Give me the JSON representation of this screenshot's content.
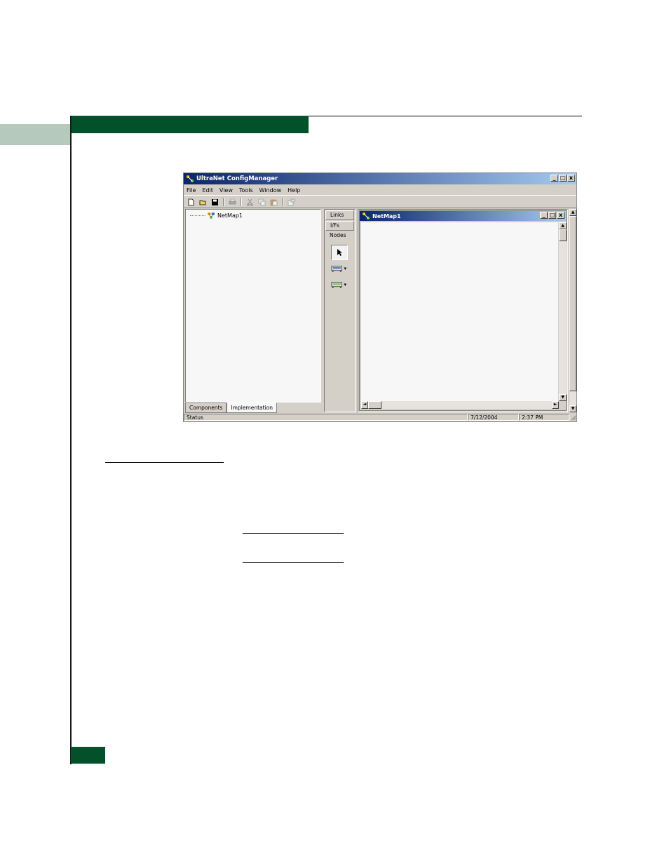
{
  "window": {
    "title": "UltraNet ConfigManager",
    "controls": {
      "minimize": "_",
      "maximize": "□",
      "close": "x"
    }
  },
  "menu": [
    "File",
    "Edit",
    "View",
    "Tools",
    "Window",
    "Help"
  ],
  "toolbar": [
    "new-file-icon",
    "open-folder-icon",
    "save-icon",
    "print-icon",
    "cut-icon",
    "copy-icon",
    "paste-icon",
    "properties-icon"
  ],
  "tree": {
    "root_label": "NetMap1"
  },
  "tree_tabs": [
    "Components",
    "Implementation"
  ],
  "palette": {
    "tabs": [
      "Links",
      "I/Fs",
      "Nodes"
    ],
    "tools": [
      "pointer-icon",
      "node-device-icon",
      "node-device-icon"
    ]
  },
  "child_window": {
    "title": "NetMap1"
  },
  "status": {
    "text": "Status",
    "date": "7/12/2004",
    "time": "2:37 PM"
  },
  "colors": {
    "green": "#02512a",
    "gray_tab": "#b5c9bc",
    "titlebar": "#0a246a"
  }
}
